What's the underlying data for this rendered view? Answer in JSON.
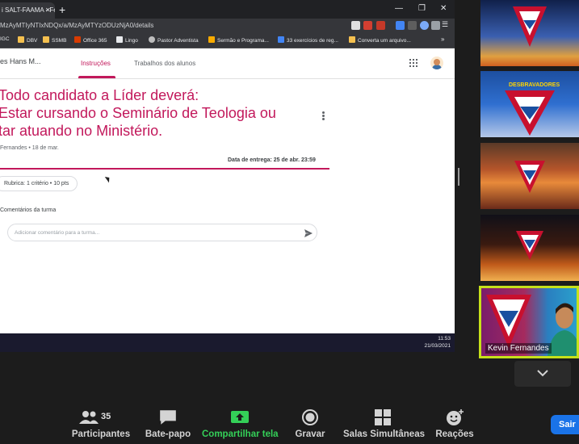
{
  "browser": {
    "tab_title": "i SALT-FAAMA - Fer",
    "url": "MzAyMTIyNTIxNDQx/a/MzAyMTYzODUzNjA0/details",
    "bookmarks": [
      "IGC",
      "DBV",
      "SSMB",
      "Office 365",
      "Lingo",
      "Pastor Adventista",
      "Sermão e Programa...",
      "33 exercícios de reg...",
      "Converta um arquivo..."
    ]
  },
  "classroom": {
    "class_title": "es Hans M...",
    "tabs": [
      "Instruções",
      "Trabalhos dos alunos"
    ],
    "instructions": [
      "Todo candidato a Líder deverá:",
      "Estar cursando o Seminário de Teologia ou",
      "tar atuando no Ministério."
    ],
    "meta": "Fernandes • 18 de mar.",
    "due": "Data de entrega: 25 de abr. 23:59",
    "rubric": "Rubrica: 1 critério • 10 pts",
    "comments_label": "Comentários da turma",
    "comment_placeholder": "Adicionar comentário para a turma..."
  },
  "taskbar": {
    "time": "11:53",
    "date": "21/03/2021"
  },
  "gallery": {
    "thumb2_text": "DESBRAVADORES",
    "speaker_name": "Kevin Fernandes"
  },
  "toolbar": {
    "participants_count": "35",
    "participants": "Participantes",
    "chat": "Bate-papo",
    "share": "Compartilhar tela",
    "record": "Gravar",
    "rooms": "Salas Simultâneas",
    "reactions": "Reações",
    "leave": "Sair"
  },
  "colors": {
    "accent": "#c2185b",
    "share_green": "#34d058",
    "speaker_border": "#c6e11a",
    "leave_blue": "#1a73e8"
  }
}
